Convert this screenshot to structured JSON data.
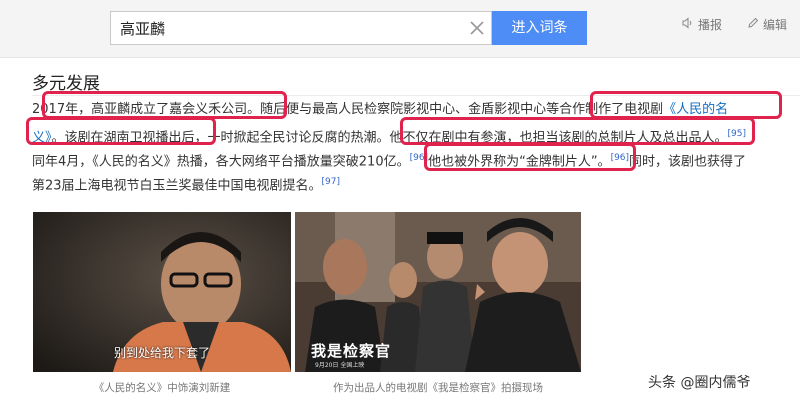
{
  "search": {
    "value": "高亚麟",
    "button_label": "进入词条"
  },
  "tools": {
    "listen_label": "播报",
    "edit_label": "编辑"
  },
  "section": {
    "title": "多元发展"
  },
  "paragraph": {
    "line1_a": "2017年，高亚麟成立了嘉会义禾公司。随后便与最高人民检察院影视中心、金盾影视中心等合作制作了电视剧",
    "line1_link": "《人民的名",
    "line2_link": "义》",
    "line2_a": "。该剧在湖南卫视播出后，一时掀起全民讨论反腐的热潮。他不仅在剧中有参演，也担当该剧的总制片人及总出品人。",
    "ref_95": "[95]",
    "line3_a": "同年4月，《人民的名义》热播，各大网络平台播放量突破210亿。",
    "ref_96a": "[96]",
    "line3_b": "他也被外界称为“金牌制片人”。",
    "ref_96b": "[96]",
    "line3_c": "同时，该剧也获得了",
    "line4_a": "第23届上海电视节白玉兰奖最佳中国电视剧提名。",
    "ref_97": "[97]"
  },
  "images": [
    {
      "subtitle": "别到处给我下套了",
      "caption": "《人民的名义》中饰演刘新建"
    },
    {
      "poster_title": "我是检察官",
      "poster_date": "9月20日  全国上映",
      "caption": "作为出品人的电视剧《我是检察官》拍摄现场"
    }
  ],
  "watermark": "头条 @圈内儒爷",
  "colors": {
    "accent": "#4e8df5",
    "highlight": "#e0234d",
    "link": "#136ec2"
  }
}
